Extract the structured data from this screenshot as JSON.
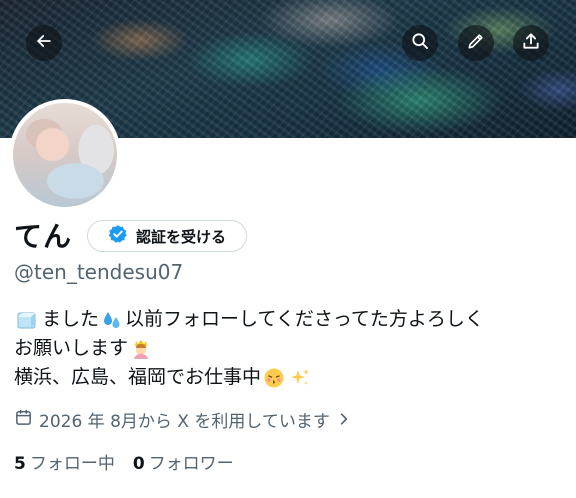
{
  "header": {
    "back_icon": "arrow-left-icon",
    "actions": [
      "search-icon",
      "edit-icon",
      "share-icon"
    ]
  },
  "profile": {
    "display_name": "てん",
    "verify_button_label": "認証を受ける",
    "handle": "@ten_tendesu07",
    "bio_lines": [
      {
        "pre": "",
        "text1": "ました",
        "text2": "以前フォローしてくださってた方よろしく"
      },
      {
        "text": "お願いします"
      },
      {
        "text": "横浜、広島、福岡でお仕事中"
      }
    ],
    "joined": "2026 年 8月から X を利用しています",
    "following_count": "5",
    "following_label": "フォロー中",
    "followers_count": "0",
    "followers_label": "フォロワー"
  },
  "colors": {
    "accent": "#1d9bf0",
    "text": "#0f1419",
    "muted": "#536471"
  }
}
